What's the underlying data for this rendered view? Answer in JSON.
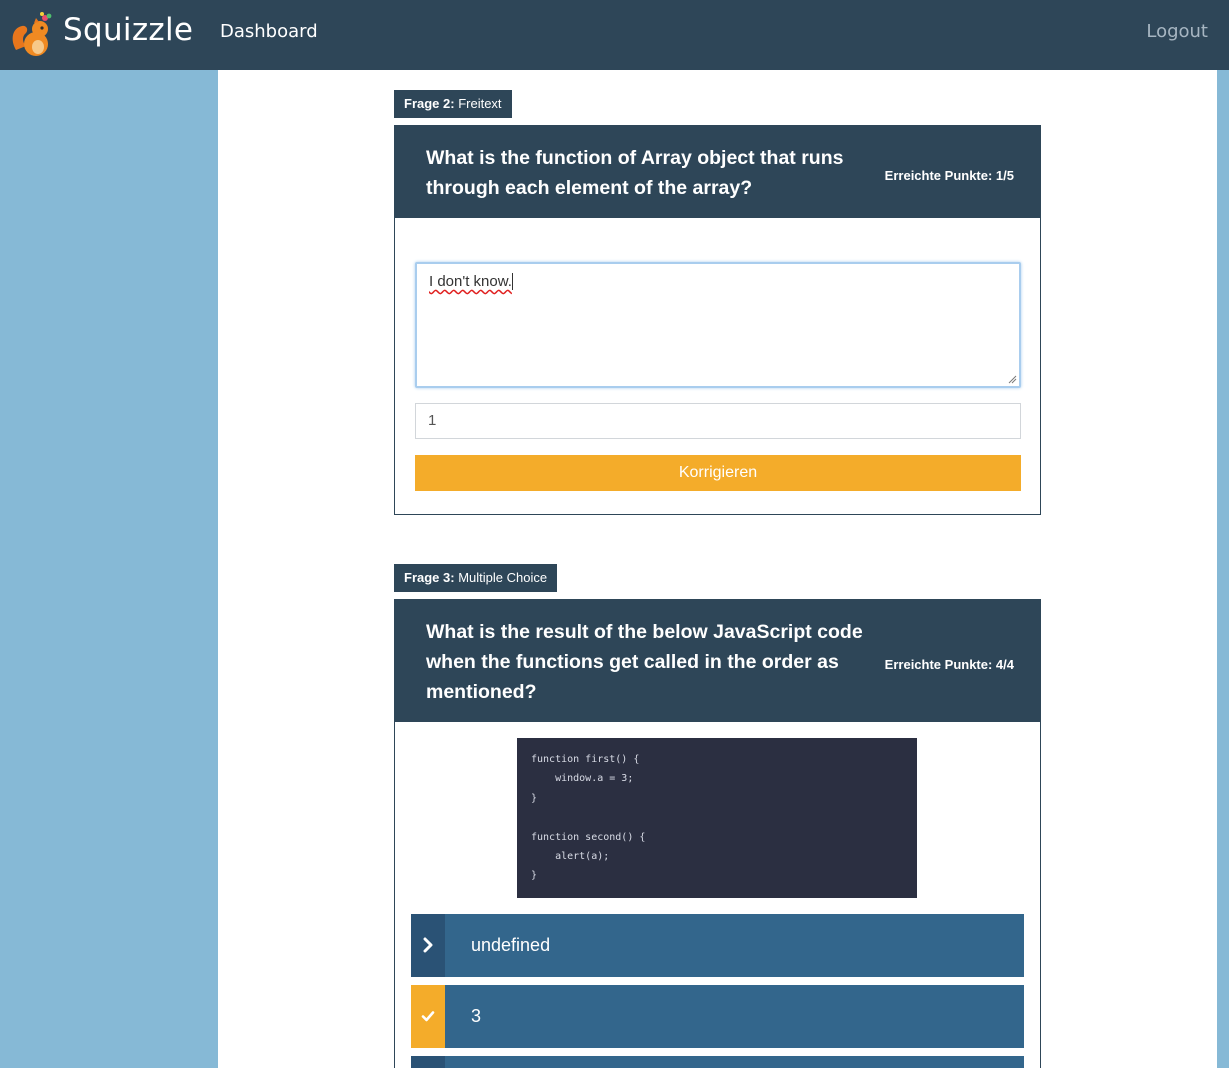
{
  "navbar": {
    "brand": "Squizzle",
    "nav_dashboard": "Dashboard",
    "logout": "Logout"
  },
  "questions": [
    {
      "tag_number": "Frage 2:",
      "tag_type": "Freitext",
      "title_line1": "What is the function of Array object that runs",
      "title_line2": "through each element of the array?",
      "points": "Erreichte Punkte: 1/5",
      "answer_text": "I don't know.",
      "points_input": "1",
      "correct_button": "Korrigieren"
    },
    {
      "tag_number": "Frage 3:",
      "tag_type": "Multiple Choice",
      "title_line1": "What is the result of the below JavaScript code",
      "title_line2": "when the functions get called in the order as",
      "title_line3": "mentioned?",
      "points": "Erreichte Punkte: 4/4",
      "code_lines": [
        "function first() {",
        "    window.a = 3;",
        "}",
        "",
        "function second() {",
        "    alert(a);",
        "}"
      ],
      "options": [
        {
          "label": "undefined",
          "marker_icon": "chevron-right-icon",
          "selected_correct": false
        },
        {
          "label": "3",
          "marker_icon": "check-icon",
          "selected_correct": true
        },
        {
          "label": "",
          "marker_icon": "",
          "selected_correct": false
        }
      ]
    }
  ],
  "colors": {
    "navbar": "#2e4658",
    "background": "#86b9d6",
    "accent": "#f4ac2a",
    "option": "#33668c"
  }
}
